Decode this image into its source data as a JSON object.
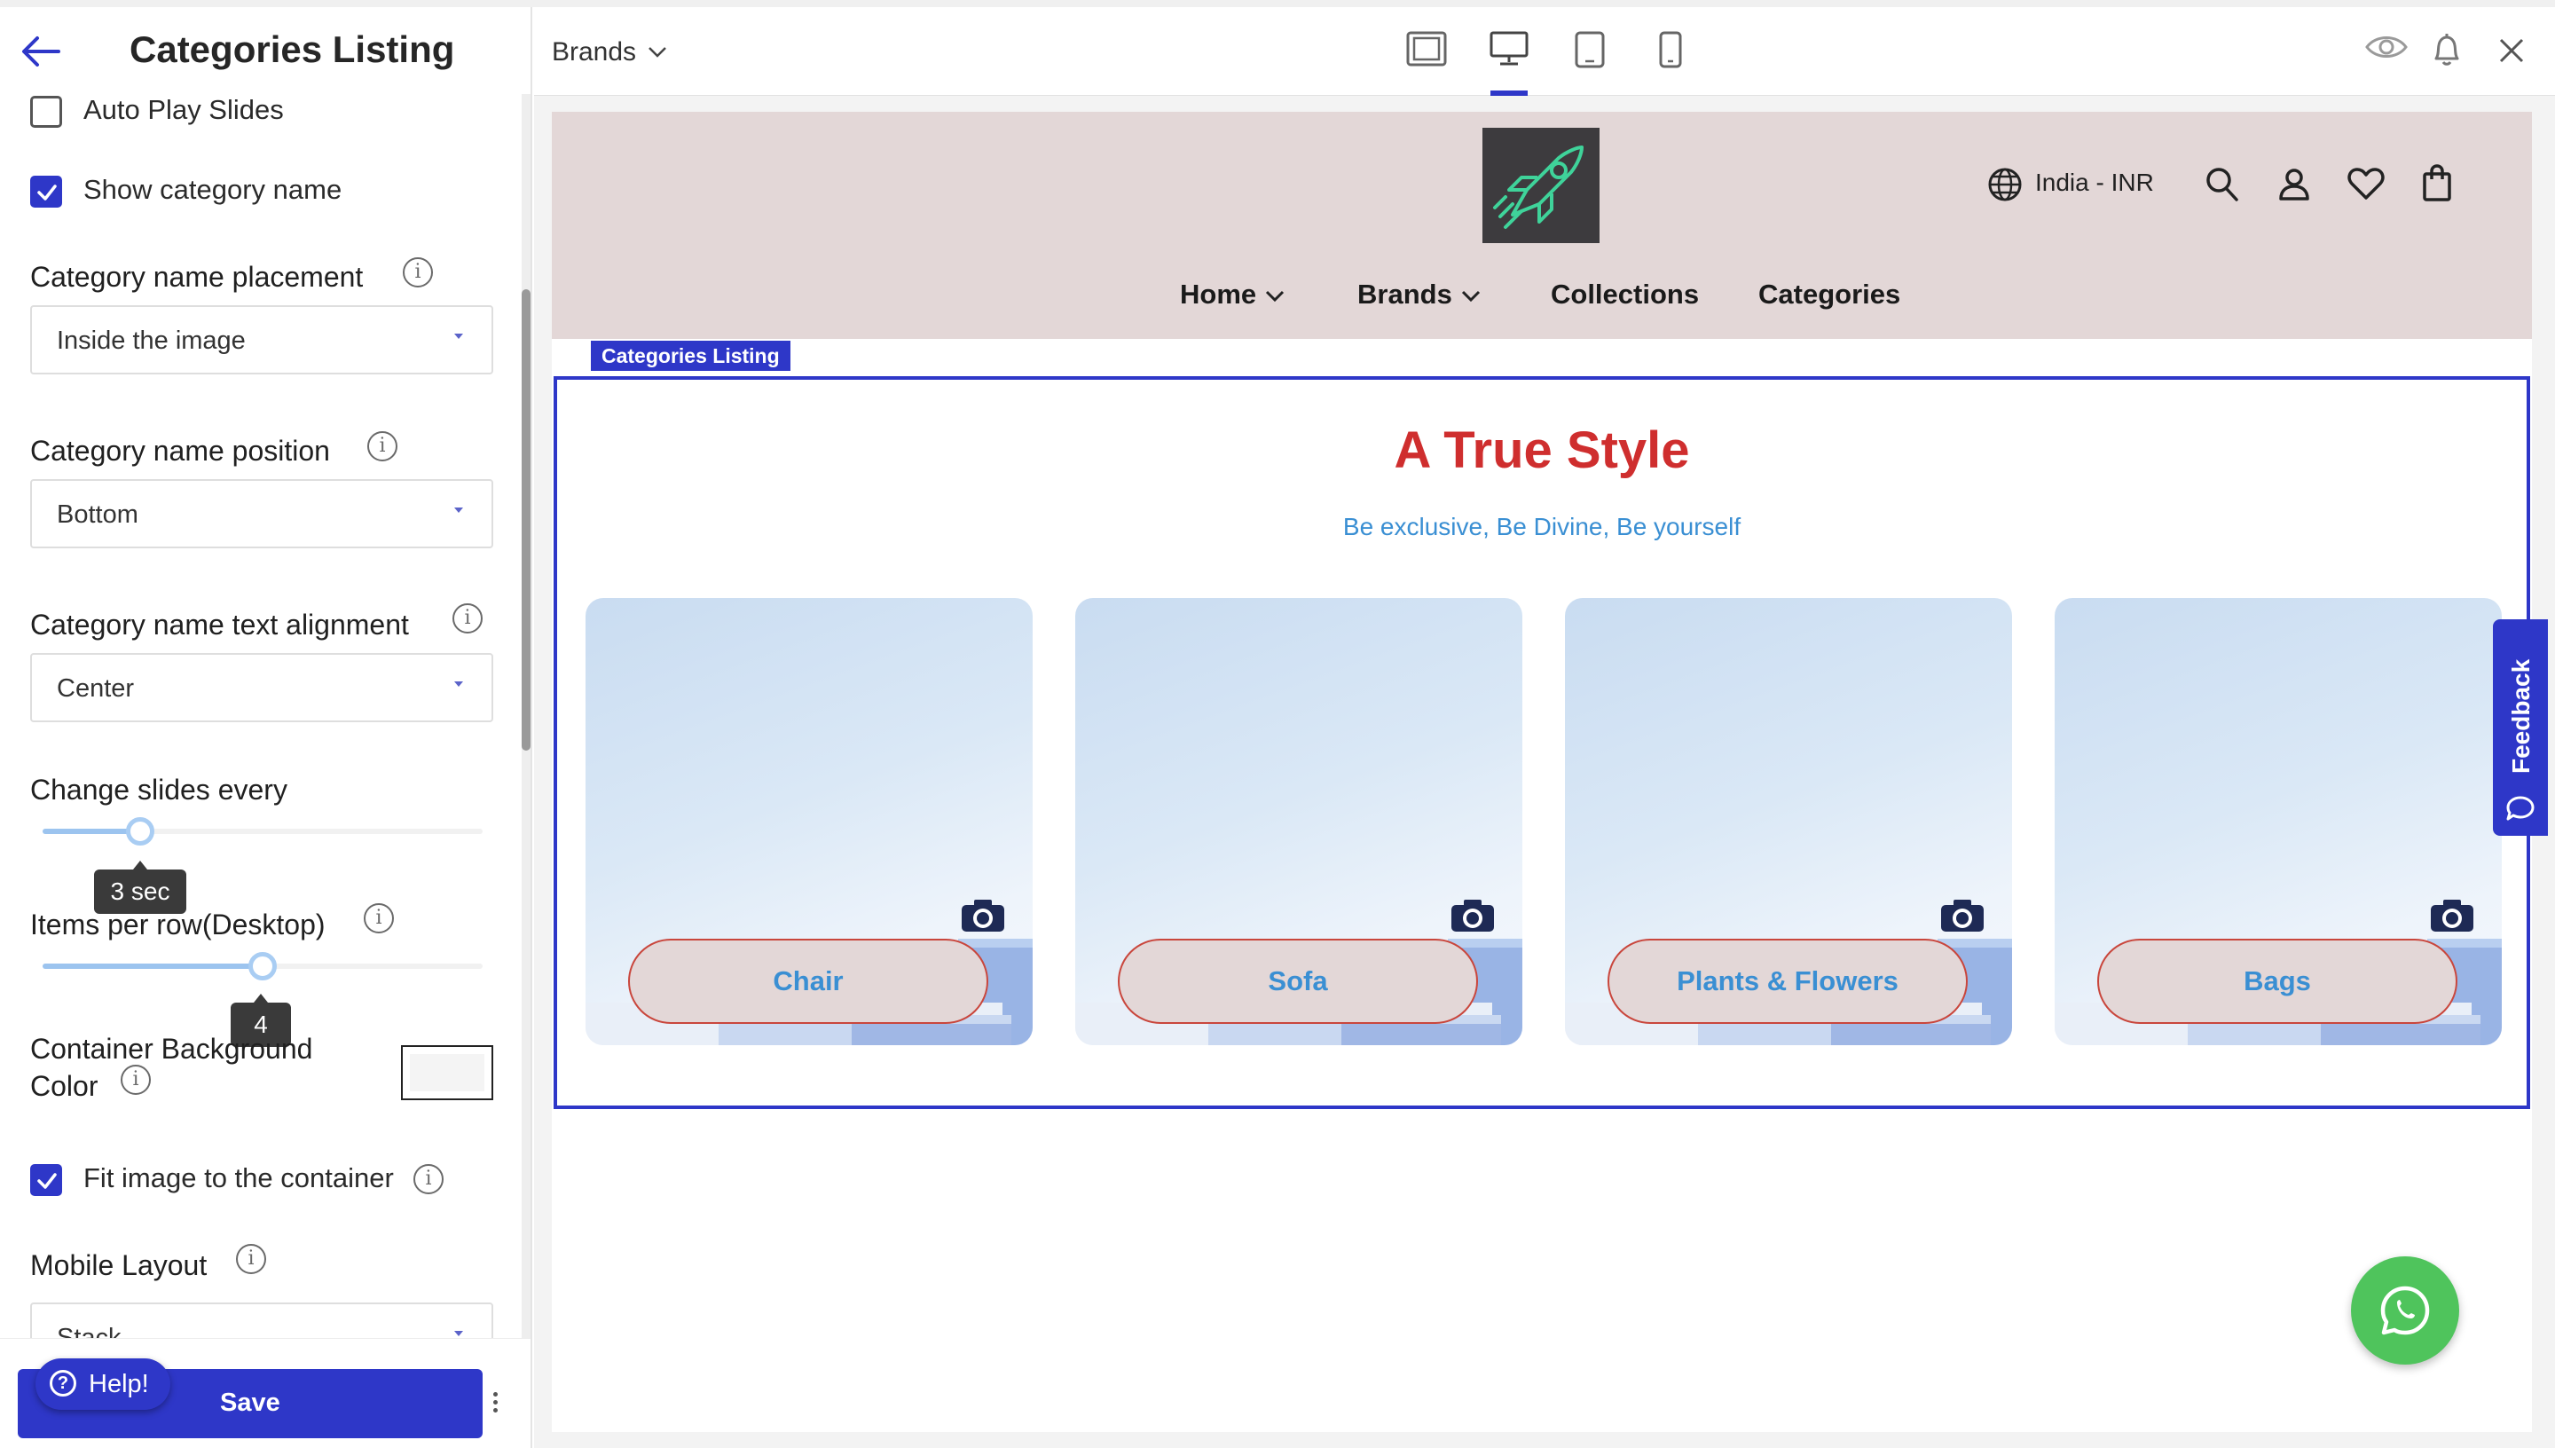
{
  "sidebar": {
    "title": "Categories Listing",
    "options": {
      "auto_play": {
        "label": "Auto Play Slides",
        "checked": false
      },
      "show_name": {
        "label": "Show category name",
        "checked": true
      },
      "fit_image": {
        "label": "Fit image to the container",
        "checked": true
      }
    },
    "fields": {
      "placement": {
        "label": "Category name placement",
        "value": "Inside the image"
      },
      "position": {
        "label": "Category name position",
        "value": "Bottom"
      },
      "alignment": {
        "label": "Category name text alignment",
        "value": "Center"
      },
      "change_slides": {
        "label": "Change slides every",
        "value_text": "3 sec",
        "level": 0.2
      },
      "items_per_row": {
        "label": "Items per row(Desktop)",
        "value_text": "4",
        "level": 0.5
      },
      "bg_color": {
        "label_line1": "Container Background",
        "label_line2": "Color",
        "value": "#f4f4f4"
      },
      "mobile_layout": {
        "label": "Mobile Layout",
        "value": "Stack"
      }
    },
    "footer": {
      "save_label": "Save",
      "help_label": "Help!"
    }
  },
  "topbar": {
    "page_select": "Brands",
    "devices": [
      "fullscreen-icon",
      "desktop-icon",
      "tablet-icon",
      "mobile-icon"
    ],
    "active_device": "desktop-icon",
    "actions": [
      "eye-icon",
      "bell-icon",
      "close-icon"
    ]
  },
  "site": {
    "locale": "India - INR",
    "nav": [
      {
        "label": "Home",
        "dropdown": true
      },
      {
        "label": "Brands",
        "dropdown": true
      },
      {
        "label": "Collections",
        "dropdown": false
      },
      {
        "label": "Categories",
        "dropdown": false
      }
    ],
    "header_icons": [
      "globe-icon",
      "search-icon",
      "user-icon",
      "heart-icon",
      "bag-icon"
    ],
    "section_tag": "Categories Listing",
    "section_title": "A True Style",
    "section_subtitle": "Be exclusive, Be Divine, Be yourself",
    "categories": [
      {
        "name": "Chair"
      },
      {
        "name": "Sofa"
      },
      {
        "name": "Plants & Flowers"
      },
      {
        "name": "Bags"
      }
    ],
    "feedback_label": "Feedback"
  },
  "colors": {
    "accent": "#2e37c8",
    "header_bg": "#e3d7d7",
    "title_red": "#cf2e2e",
    "link_blue": "#3a8fd3",
    "whatsapp": "#4fc45c"
  }
}
